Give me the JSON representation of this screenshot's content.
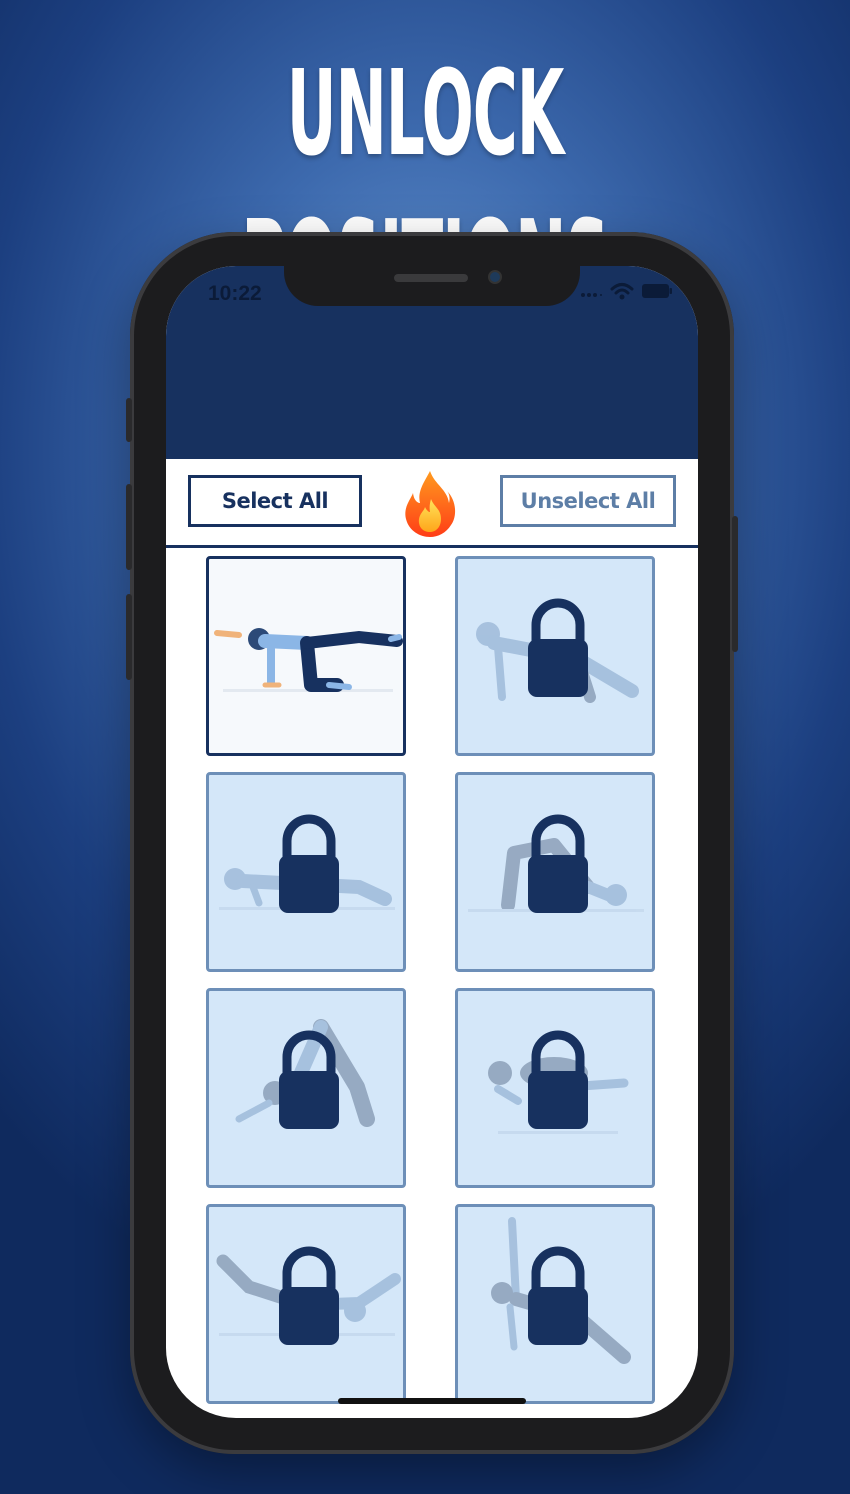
{
  "promo": {
    "headline": "UNLOCK POSITIONS"
  },
  "status_bar": {
    "time": "10:22",
    "icons": [
      "signal-dots-icon",
      "wifi-icon",
      "battery-icon"
    ]
  },
  "toolbar": {
    "select_all_label": "Select All",
    "unselect_all_label": "Unselect All",
    "center_icon": "flame-icon"
  },
  "positions": [
    {
      "locked": false,
      "icon": "yoga-pose-icon"
    },
    {
      "locked": true,
      "icon": "lock-icon"
    },
    {
      "locked": true,
      "icon": "lock-icon"
    },
    {
      "locked": true,
      "icon": "lock-icon"
    },
    {
      "locked": true,
      "icon": "lock-icon"
    },
    {
      "locked": true,
      "icon": "lock-icon"
    },
    {
      "locked": true,
      "icon": "lock-icon"
    },
    {
      "locked": true,
      "icon": "lock-icon"
    }
  ],
  "colors": {
    "navy": "#17315f",
    "locked_card": "#d4e7f9",
    "locked_border": "#6d8fb8",
    "unlocked_card": "#f6f9fc",
    "flame_outer": "#ff6a1a",
    "flame_inner": "#ffc21a"
  }
}
